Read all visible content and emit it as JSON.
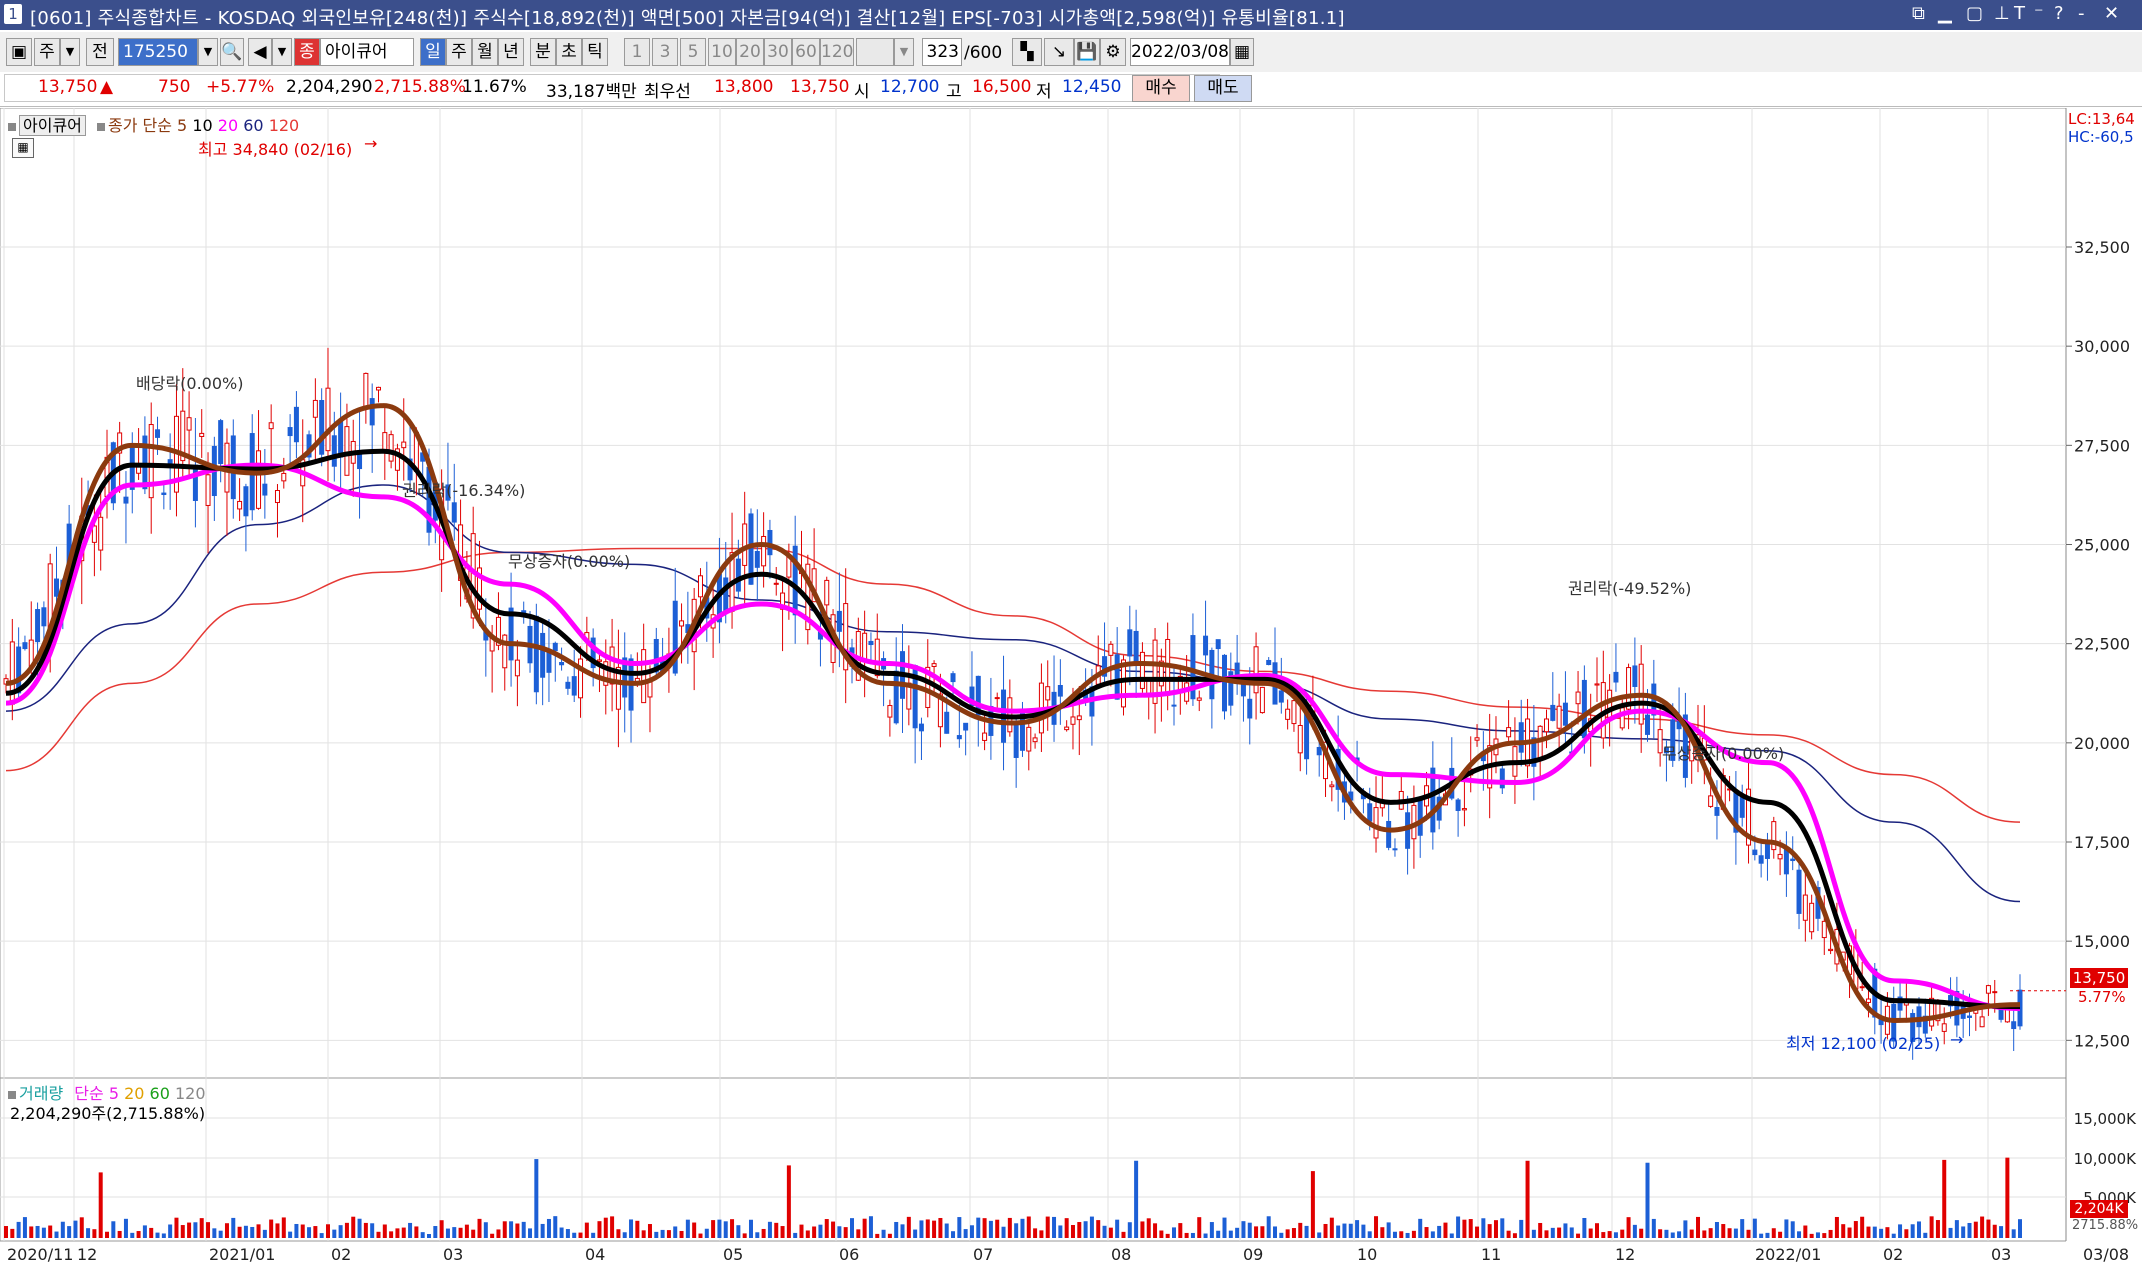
{
  "window": {
    "number": "1",
    "title": "[0601] 주식종합차트 - KOSDAQ 외국인보유[248(천)] 주식수[18,892(천)] 액면[500] 자본금[94(억)] 결산[12월] EPS[-703] 시가총액[2,598(억)] 유통비율[81.1]"
  },
  "toolbar": {
    "mode": "주",
    "prev_label": "전",
    "code": "175250",
    "stock_prefix": "종",
    "stock_name": "아이큐어",
    "periods": [
      "일",
      "주",
      "월",
      "년",
      "분",
      "초",
      "틱"
    ],
    "active_period": "일",
    "minute_options": [
      "1",
      "3",
      "5",
      "10",
      "20",
      "30",
      "60",
      "120"
    ],
    "count_value": "323",
    "count_max": "/600",
    "date": "2022/03/08"
  },
  "quote": {
    "price": "13,750",
    "arrow": "▲",
    "change": "750",
    "change_pct": "+5.77%",
    "volume": "2,204,290",
    "volume_pct": "2,715.88%",
    "turnover": "11.67%",
    "amount": "33,187백만",
    "best_label": "최우선",
    "ask": "13,800",
    "bid": "13,750",
    "open_label": "시",
    "open": "12,700",
    "high_label": "고",
    "high": "16,500",
    "low_label": "저",
    "low": "12,450",
    "buy_label": "매수",
    "sell_label": "매도"
  },
  "chart_data": {
    "type": "line",
    "description_legend": {
      "name": "아이큐어",
      "ma_prefix": "종가 단순",
      "ma_periods": [
        "5",
        "10",
        "20",
        "60",
        "120"
      ],
      "ma_colors": [
        "#8b3a0f",
        "#000000",
        "#ff00ff",
        "#1a237e",
        "#e53935"
      ]
    },
    "price_axis": {
      "ticks": [
        "32,500",
        "30,000",
        "27,500",
        "25,000",
        "22,500",
        "20,000",
        "17,500",
        "15,000",
        "12,500"
      ],
      "ylim": [
        11500,
        35500
      ],
      "lc_label": "LC:13,64",
      "hc_label": "HC:-60,5",
      "current_price": "13,750",
      "current_pct": "5.77%"
    },
    "x_labels": [
      "2020/11",
      "12",
      "2021/01",
      "02",
      "03",
      "04",
      "05",
      "06",
      "07",
      "08",
      "09",
      "10",
      "11",
      "12",
      "2022/01",
      "02",
      "03",
      "03/08"
    ],
    "annotations": {
      "high": "최고 34,840 (02/16)",
      "low": "최저 12,100 (02/25)",
      "events": [
        "배당락(0.00%)",
        "권리락(-16.34%)",
        "무상증자(0.00%)",
        "권리락(-49.52%)",
        "무상증자(0.00%)"
      ]
    },
    "close_series": {
      "x": [
        "2020/11/12",
        "2020/12",
        "2021/01",
        "2021/02",
        "2021/03",
        "2021/04",
        "2021/05",
        "2021/06",
        "2021/07",
        "2021/08",
        "2021/09",
        "2021/10",
        "2021/11",
        "2021/12",
        "2022/01",
        "2022/02",
        "2022/03/08"
      ],
      "ma5": [
        21500,
        27500,
        26800,
        28500,
        22500,
        21500,
        25000,
        21500,
        20500,
        22000,
        21500,
        17800,
        20000,
        21200,
        17500,
        13000,
        13400
      ],
      "ma20": [
        21000,
        26500,
        27000,
        26200,
        24000,
        22000,
        23500,
        22000,
        20800,
        21200,
        21700,
        19200,
        19000,
        20800,
        19500,
        14000,
        13300
      ],
      "ma60": [
        20800,
        23000,
        25500,
        26500,
        24800,
        24500,
        23600,
        22800,
        22600,
        21800,
        21500,
        20600,
        20300,
        20100,
        19800,
        18000,
        16000
      ],
      "ma120": [
        19300,
        21500,
        23500,
        24300,
        24800,
        24900,
        24900,
        24000,
        23200,
        22200,
        21800,
        21300,
        20900,
        20600,
        20200,
        19200,
        18000
      ]
    },
    "volume_panel": {
      "legend_name": "거래량",
      "ma_prefix": "단순",
      "ma_periods": [
        "5",
        "20",
        "60",
        "120"
      ],
      "ma_colors": [
        "#e91ee8",
        "#e0a000",
        "#1aa01a",
        "#888888"
      ],
      "summary": "2,204,290주(2,715.88%)",
      "ticks": [
        "15,000K",
        "10,000K",
        "5,000K"
      ],
      "current": "2,204K",
      "current_pct": "2715.88%"
    }
  },
  "colors": {
    "titlebar": "#3b4f8c",
    "up": "#e00000",
    "down": "#0033cc"
  }
}
